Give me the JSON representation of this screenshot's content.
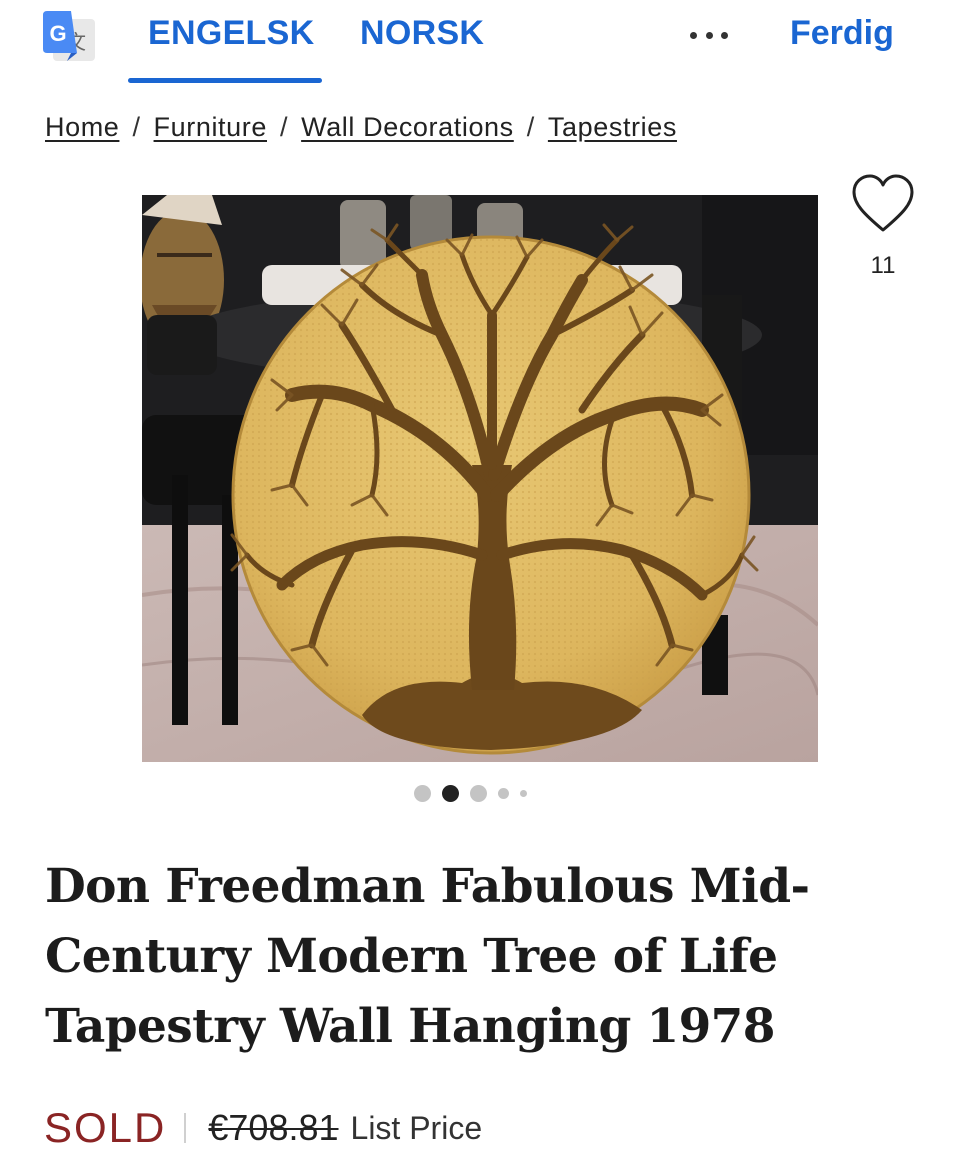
{
  "translate_bar": {
    "logo_icon": "google-translate-icon",
    "source_language": "ENGELSK",
    "target_language": "NORSK",
    "more_icon": "more-horizontal-icon",
    "done_label": "Ferdig",
    "accent_color": "#1a66d2"
  },
  "breadcrumb": {
    "items": [
      "Home",
      "Furniture",
      "Wall Decorations",
      "Tapestries"
    ],
    "separator": "/"
  },
  "favorite": {
    "icon": "heart-outline-icon",
    "count": "11"
  },
  "carousel": {
    "total_dots": 5,
    "active_index": 1
  },
  "product": {
    "title": "Don Freedman Fabulous Mid-Century Modern Tree of Life Tapestry Wall Hanging 1978",
    "status": "SOLD",
    "status_color": "#8a2424",
    "list_price": "€708.81",
    "price_label": "List Price"
  }
}
